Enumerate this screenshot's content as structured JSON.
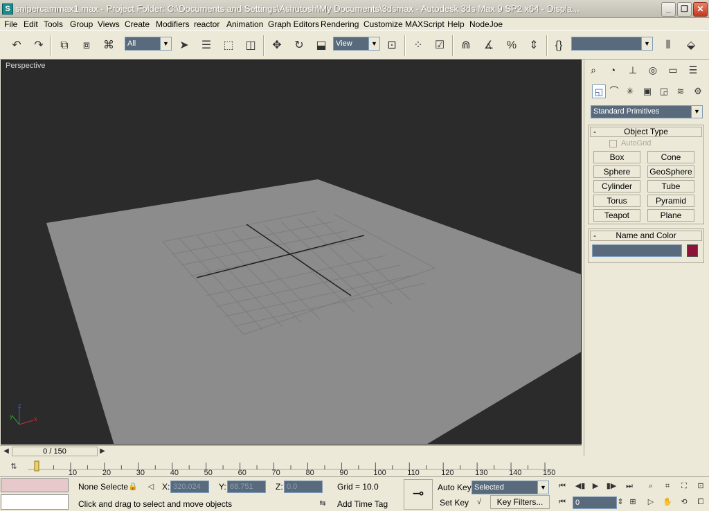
{
  "window": {
    "title": "snipercammax1.max     - Project Folder: C:\\Documents and Settings\\Ashutosh\\My Documents\\3dsmax     - Autodesk 3ds Max 9 SP2 x64     - Displa..."
  },
  "menu": [
    "File",
    "Edit",
    "Tools",
    "Group",
    "Views",
    "Create",
    "Modifiers",
    "reactor",
    "Animation",
    "Graph Editors",
    "Rendering",
    "Customize",
    "MAXScript",
    "Help",
    "NodeJoe"
  ],
  "toolbar": {
    "selection_filter": "All",
    "reference_coord": "View",
    "named_selection": ""
  },
  "viewport": {
    "label": "Perspective",
    "axis_x": "x",
    "axis_y": "y",
    "axis_z": "z"
  },
  "command_panel": {
    "category": "Standard Primitives",
    "object_type_title": "Object Type",
    "autogrid_label": "AutoGrid",
    "buttons": [
      "Box",
      "Cone",
      "Sphere",
      "GeoSphere",
      "Cylinder",
      "Tube",
      "Torus",
      "Pyramid",
      "Teapot",
      "Plane"
    ],
    "name_color_title": "Name and Color",
    "swatch_color": "#8b1438"
  },
  "time": {
    "slider_label": "0 / 150",
    "ticks": [
      "10",
      "20",
      "30",
      "40",
      "50",
      "60",
      "70",
      "80",
      "90",
      "100",
      "110",
      "120",
      "130",
      "140",
      "150"
    ],
    "current_frame": "0"
  },
  "status": {
    "selection": "None Selecte",
    "x_label": "X:",
    "x_value": "320.024",
    "y_label": "Y:",
    "y_value": "68.751",
    "z_label": "Z:",
    "z_value": "0.0",
    "grid": "Grid = 10.0",
    "prompt": "Click and drag to select and move objects",
    "add_time_tag": "Add Time Tag",
    "auto_key": "Auto Key",
    "set_key": "Set Key",
    "key_mode": "Selected",
    "key_filters": "Key Filters..."
  }
}
